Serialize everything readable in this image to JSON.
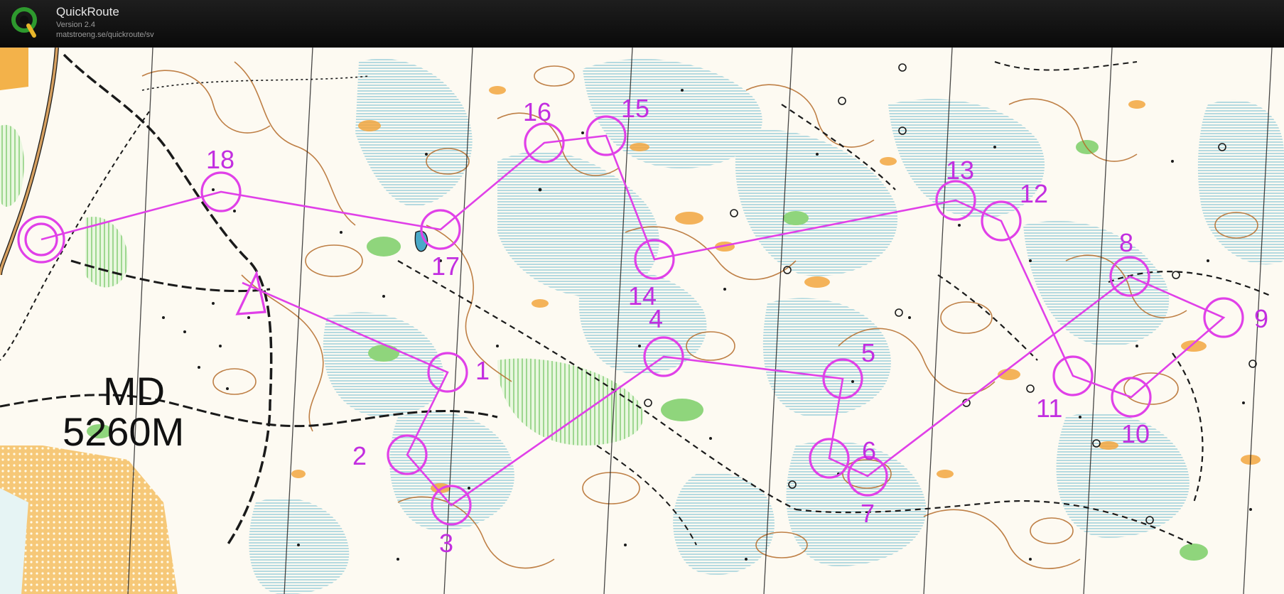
{
  "app": {
    "title": "QuickRoute",
    "version": "Version 2.4",
    "url": "matstroeng.se/quickroute/sv"
  },
  "colors": {
    "course": "#e040e8",
    "label": "#c22ee0",
    "water": "#9fd3de",
    "vegetation": "#b8e7a6",
    "contour": "#b46a28",
    "rock": "#f2a640",
    "path": "#1a1a1a",
    "background": "#fdfaf2"
  },
  "map": {
    "course_info": [
      "MD",
      "5260M"
    ],
    "start": {
      "name": "Start"
    },
    "finish": {
      "name": "Finish"
    },
    "controls": [
      {
        "number": "1"
      },
      {
        "number": "2"
      },
      {
        "number": "3"
      },
      {
        "number": "4"
      },
      {
        "number": "5"
      },
      {
        "number": "6"
      },
      {
        "number": "7"
      },
      {
        "number": "8"
      },
      {
        "number": "9"
      },
      {
        "number": "10"
      },
      {
        "number": "11"
      },
      {
        "number": "12"
      },
      {
        "number": "13"
      },
      {
        "number": "14"
      },
      {
        "number": "15"
      },
      {
        "number": "16"
      },
      {
        "number": "17"
      },
      {
        "number": "18"
      }
    ]
  }
}
